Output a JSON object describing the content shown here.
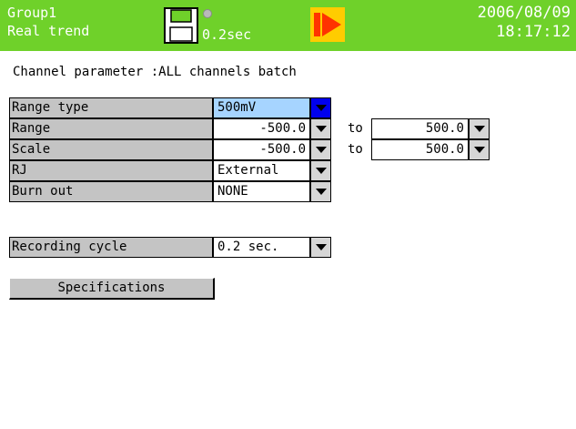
{
  "header": {
    "group": "Group1",
    "mode": "Real trend",
    "date": "2006/08/09",
    "time": "18:17:12",
    "cycle": "0.2sec",
    "icons": [
      "save-disk-icon",
      "status-dot-icon",
      "record-icon"
    ],
    "colors": {
      "bar": "#6fd12a",
      "text": "#ffffff",
      "icon_bg": "#ffcc00",
      "icon_red": "#ff3300"
    }
  },
  "subtitle": "Channel parameter :ALL channels batch",
  "params": {
    "range_type": {
      "label": "Range type",
      "value": "500mV"
    },
    "range": {
      "label": "Range",
      "from": "-500.0",
      "to_label": "to",
      "to": "500.0"
    },
    "scale": {
      "label": "Scale",
      "from": "-500.0",
      "to_label": "to",
      "to": "500.0"
    },
    "rj": {
      "label": "RJ",
      "value": "External"
    },
    "burnout": {
      "label": "Burn out",
      "value": "NONE"
    },
    "recording_cycle": {
      "label": "Recording cycle",
      "value": "0.2 sec."
    }
  },
  "specifications_button": "Specifications",
  "colors": {
    "label_bg": "#c4c4c4",
    "selected_bg": "#a6d4ff",
    "focus_dropdown": "#0000ee"
  }
}
